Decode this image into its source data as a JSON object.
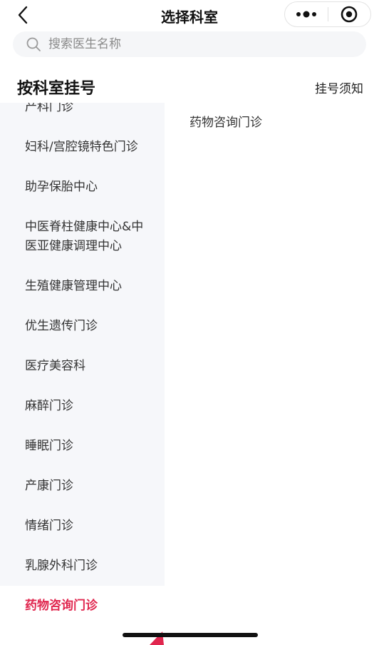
{
  "nav": {
    "title": "选择科室"
  },
  "search": {
    "placeholder": "搜索医生名称"
  },
  "section": {
    "title": "按科室挂号",
    "notice_label": "挂号须知"
  },
  "departments": [
    {
      "label": "产科门诊"
    },
    {
      "label": "妇科/宫腔镜特色门诊"
    },
    {
      "label": "助孕保胎中心"
    },
    {
      "label": "中医脊柱健康中心&中医亚健康调理中心"
    },
    {
      "label": "生殖健康管理中心"
    },
    {
      "label": "优生遗传门诊"
    },
    {
      "label": "医疗美容科"
    },
    {
      "label": "麻醉门诊"
    },
    {
      "label": "睡眠门诊"
    },
    {
      "label": "产康门诊"
    },
    {
      "label": "情绪门诊"
    },
    {
      "label": "乳腺外科门诊"
    },
    {
      "label": "药物咨询门诊"
    }
  ],
  "selected_department_index": 12,
  "clinics": [
    {
      "label": "药物咨询门诊"
    }
  ],
  "colors": {
    "accent": "#e0264e",
    "sidebar_bg": "#f6f7fa",
    "search_bg": "#f5f6f8"
  },
  "icons": {
    "back": "chevron-left-icon",
    "more": "more-dots-icon",
    "close": "target-circle-icon",
    "search": "search-icon"
  }
}
